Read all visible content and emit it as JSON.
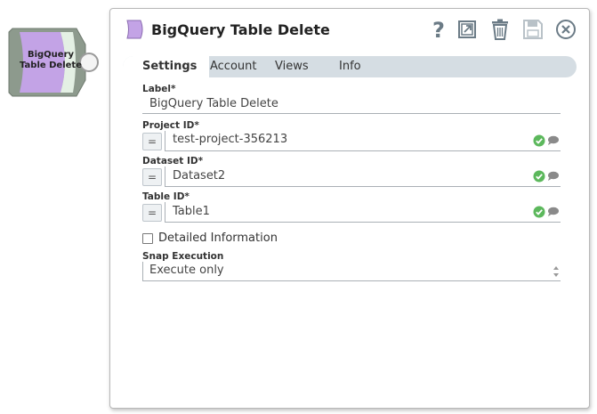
{
  "snap_node": {
    "label_line1": "BigQuery",
    "label_line2": "Table Delete",
    "color": "#c3a3e6"
  },
  "dialog": {
    "title": "BigQuery Table Delete",
    "icons": [
      "help-icon",
      "export-icon",
      "delete-icon",
      "save-icon",
      "close-icon"
    ]
  },
  "tabs": [
    {
      "label": "Settings",
      "active": true
    },
    {
      "label": "Account",
      "active": false
    },
    {
      "label": "Views",
      "active": false
    },
    {
      "label": "Info",
      "active": false
    }
  ],
  "fields": {
    "label": {
      "label": "Label*",
      "value": "BigQuery Table Delete"
    },
    "project_id": {
      "label": "Project ID*",
      "value": "test-project-356213",
      "expr": "="
    },
    "dataset_id": {
      "label": "Dataset ID*",
      "value": "Dataset2",
      "expr": "="
    },
    "table_id": {
      "label": "Table ID*",
      "value": "Table1",
      "expr": "="
    },
    "detailed_information": {
      "label": "Detailed Information",
      "checked": false
    },
    "snap_execution": {
      "label": "Snap Execution",
      "value": "Execute only"
    }
  },
  "colors": {
    "accent_green": "#5cb85c",
    "tab_bar": "#d5dde3",
    "snap_purple": "#c3a3e6"
  }
}
